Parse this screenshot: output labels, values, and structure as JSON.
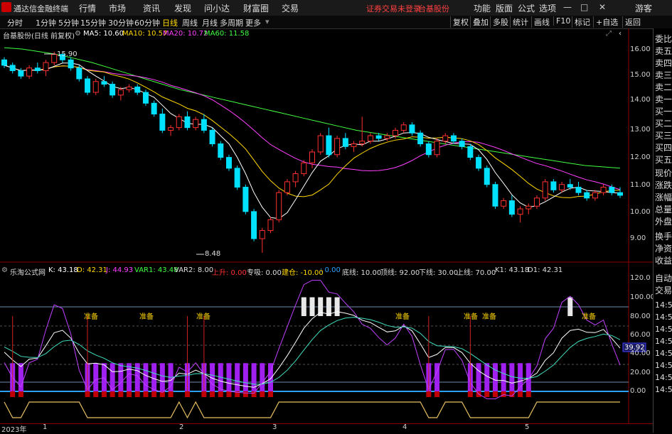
{
  "app_title": "通达信金融终端",
  "top_menu": [
    "行情",
    "市场",
    "资讯",
    "发现",
    "问小达",
    "财富圈",
    "交易"
  ],
  "notice": "证券交易未登录",
  "stock_name": "台基股份",
  "top_right": [
    "功能",
    "版面",
    "公式",
    "选项"
  ],
  "guest": "游客",
  "period_tabs": [
    "分时",
    "1分钟",
    "5分钟",
    "15分钟",
    "30分钟",
    "60分钟",
    "日线",
    "周线",
    "月线",
    "多周期",
    "更多"
  ],
  "active_period": "日线",
  "tool_buttons": [
    "复权",
    "叠加",
    "多股",
    "统计",
    "画线",
    "F10",
    "标记",
    "+自选",
    "返回"
  ],
  "main_info": {
    "title": "台基股份(日线 前复权)",
    "ma5": "MA5: 10.60",
    "ma10": "MA10: 10.57",
    "ma20": "MA20: 10.72",
    "ma60": "MA60: 11.58"
  },
  "colors": {
    "up": "#ff3030",
    "down": "#00e0ff",
    "ma5": "#ffffff",
    "ma10": "#ffd700",
    "ma20": "#ff40ff",
    "ma60": "#40ff40"
  },
  "price_axis": [
    "16.00",
    "15.00",
    "14.00",
    "13.00",
    "12.00",
    "11.00",
    "10.00",
    "9.00"
  ],
  "high_label": "15.90",
  "low_label": "8.48",
  "ind_info": {
    "name": "乐淘公式网",
    "k": "K: 43.18",
    "d": "D: 42.31",
    "j": "J: 44.93",
    "var1": "VAR1: 43.48",
    "var2": "VAR2: 8.00",
    "up": "上升: 0.00",
    "suck": "专吸: 0.00",
    "build": "建仓: -10.00",
    "zero": ": 0.00",
    "bottom": "底线: 10.00",
    "top": "顶线: 92.00",
    "lower": "下线: 30.00",
    "upper": "上线: 70.00",
    "k1": "K1: 43.18",
    "d1": "D1: 42.31"
  },
  "ind_axis": [
    "120.0",
    "100.00",
    "80.00",
    "60.00",
    "40.00",
    "20.00",
    "0.00"
  ],
  "ind_current": "39.92",
  "prepare_label": "准备",
  "x_labels": [
    "2023年",
    "1",
    "2",
    "3",
    "4",
    "5"
  ],
  "right_panel": [
    "委比",
    "卖五",
    "卖四",
    "卖三",
    "卖二",
    "卖一",
    "买一",
    "买二",
    "买三",
    "买四",
    "买五",
    "现价",
    "涨跌",
    "涨幅",
    "总量",
    "外盘",
    "换手",
    "净资",
    "收益"
  ],
  "right_panel2": [
    "自动",
    "交易"
  ],
  "times": [
    "14:56",
    "14:56",
    "14:56",
    "14:56",
    "14:56",
    "14:56",
    "14:56",
    "14:56"
  ],
  "chart_data": {
    "type": "candlestick",
    "title": "台基股份(日线 前复权)",
    "y_range": [
      8.5,
      16.5
    ],
    "ohlc": [
      [
        15.6,
        15.7,
        15.3,
        15.4
      ],
      [
        15.4,
        15.5,
        15.1,
        15.2
      ],
      [
        15.2,
        15.3,
        14.9,
        15.0
      ],
      [
        15.0,
        15.4,
        14.9,
        15.3
      ],
      [
        15.3,
        15.5,
        15.1,
        15.2
      ],
      [
        15.2,
        15.6,
        15.0,
        15.5
      ],
      [
        15.5,
        15.9,
        15.4,
        15.8
      ],
      [
        15.8,
        15.85,
        15.5,
        15.6
      ],
      [
        15.6,
        15.7,
        15.2,
        15.3
      ],
      [
        15.3,
        15.4,
        14.8,
        14.9
      ],
      [
        14.9,
        15.0,
        14.3,
        14.4
      ],
      [
        14.4,
        14.9,
        14.3,
        14.8
      ],
      [
        14.8,
        15.0,
        14.6,
        14.7
      ],
      [
        14.7,
        14.8,
        14.2,
        14.3
      ],
      [
        14.3,
        14.6,
        14.1,
        14.5
      ],
      [
        14.5,
        14.7,
        14.4,
        14.6
      ],
      [
        14.6,
        14.7,
        14.3,
        14.4
      ],
      [
        14.4,
        14.5,
        13.9,
        14.0
      ],
      [
        14.0,
        14.1,
        13.5,
        13.6
      ],
      [
        13.6,
        13.8,
        12.9,
        13.0
      ],
      [
        13.0,
        13.2,
        12.8,
        13.1
      ],
      [
        13.1,
        13.6,
        13.0,
        13.5
      ],
      [
        13.5,
        13.7,
        13.0,
        13.1
      ],
      [
        13.1,
        13.5,
        13.0,
        13.4
      ],
      [
        13.4,
        13.6,
        12.9,
        13.0
      ],
      [
        13.0,
        13.1,
        12.4,
        12.5
      ],
      [
        12.5,
        12.6,
        11.9,
        12.0
      ],
      [
        12.0,
        12.1,
        11.5,
        11.6
      ],
      [
        11.6,
        11.7,
        10.8,
        10.9
      ],
      [
        10.9,
        11.0,
        9.9,
        10.0
      ],
      [
        10.0,
        10.1,
        8.9,
        9.0
      ],
      [
        9.0,
        9.4,
        8.48,
        9.3
      ],
      [
        9.3,
        9.8,
        9.2,
        9.7
      ],
      [
        9.7,
        10.8,
        9.6,
        10.7
      ],
      [
        10.7,
        11.2,
        10.6,
        11.1
      ],
      [
        11.1,
        11.5,
        10.9,
        11.4
      ],
      [
        11.4,
        11.9,
        11.3,
        11.8
      ],
      [
        11.8,
        12.3,
        11.6,
        12.2
      ],
      [
        12.2,
        12.9,
        12.1,
        12.8
      ],
      [
        12.8,
        13.1,
        12.0,
        12.1
      ],
      [
        12.1,
        12.8,
        12.0,
        12.7
      ],
      [
        12.7,
        12.9,
        12.3,
        12.4
      ],
      [
        12.4,
        12.6,
        12.2,
        12.5
      ],
      [
        12.5,
        13.5,
        12.4,
        12.6
      ],
      [
        12.6,
        12.9,
        12.5,
        12.8
      ],
      [
        12.8,
        12.9,
        12.6,
        12.7
      ],
      [
        12.7,
        12.9,
        12.6,
        12.8
      ],
      [
        12.8,
        13.1,
        12.7,
        13.0
      ],
      [
        13.0,
        13.3,
        12.9,
        13.2
      ],
      [
        13.2,
        13.3,
        12.8,
        12.9
      ],
      [
        12.9,
        13.0,
        12.4,
        12.5
      ],
      [
        12.5,
        12.6,
        12.0,
        12.1
      ],
      [
        12.1,
        12.7,
        12.0,
        12.6
      ],
      [
        12.6,
        12.9,
        12.5,
        12.8
      ],
      [
        12.8,
        12.9,
        12.5,
        12.6
      ],
      [
        12.6,
        12.7,
        12.3,
        12.4
      ],
      [
        12.4,
        12.5,
        11.9,
        12.0
      ],
      [
        12.0,
        12.1,
        11.5,
        11.6
      ],
      [
        11.6,
        11.7,
        10.9,
        11.0
      ],
      [
        11.0,
        11.1,
        10.1,
        10.2
      ],
      [
        10.2,
        10.5,
        10.1,
        10.4
      ],
      [
        10.4,
        10.6,
        9.8,
        9.9
      ],
      [
        9.9,
        10.2,
        9.6,
        10.1
      ],
      [
        10.1,
        10.3,
        9.9,
        10.2
      ],
      [
        10.2,
        10.6,
        10.1,
        10.5
      ],
      [
        10.5,
        11.2,
        10.4,
        11.1
      ],
      [
        11.1,
        11.2,
        10.7,
        10.8
      ],
      [
        10.8,
        11.1,
        10.7,
        11.0
      ],
      [
        11.0,
        11.2,
        10.8,
        10.9
      ],
      [
        10.9,
        11.1,
        10.6,
        10.7
      ],
      [
        10.7,
        10.8,
        10.4,
        10.5
      ],
      [
        10.5,
        10.8,
        10.4,
        10.7
      ],
      [
        10.7,
        11.0,
        10.6,
        10.9
      ],
      [
        10.9,
        11.0,
        10.6,
        10.7
      ],
      [
        10.7,
        10.9,
        10.5,
        10.6
      ]
    ],
    "ma60": [
      16.05,
      16.0,
      15.9,
      15.8,
      15.65,
      15.5,
      15.3,
      15.1,
      14.9,
      14.7,
      14.5,
      14.35,
      14.2,
      14.05,
      13.9,
      13.75,
      13.6,
      13.45,
      13.3,
      13.15,
      13.0,
      12.9,
      12.8,
      12.7,
      12.6,
      12.5,
      12.4,
      12.3,
      12.2,
      12.1,
      12.0,
      11.9,
      11.8,
      11.7,
      11.65,
      11.6
    ]
  }
}
